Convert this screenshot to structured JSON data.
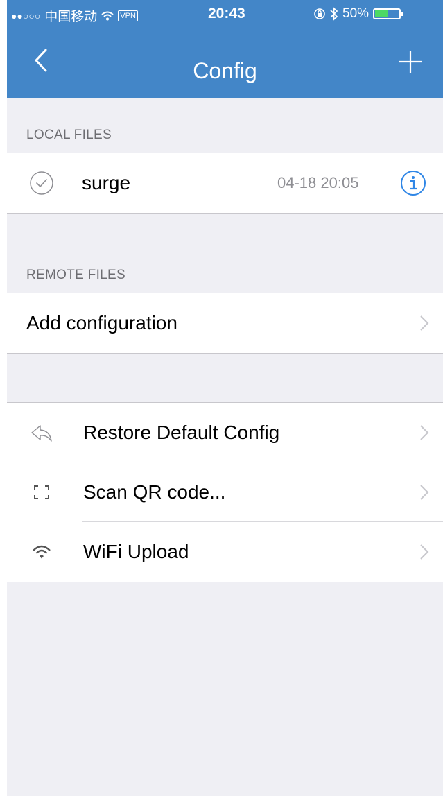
{
  "status_bar": {
    "signal": "●●○○○",
    "carrier": "中国移动",
    "vpn": "VPN",
    "time": "20:43",
    "battery": "50%",
    "battery_level": 0.5
  },
  "nav": {
    "title": "Config",
    "back_icon": "chevron-left-icon",
    "add_icon": "plus-icon"
  },
  "local_files": {
    "header": "LOCAL FILES",
    "items": [
      {
        "name": "surge",
        "date": "04-18 20:05",
        "selected": true
      }
    ]
  },
  "remote_files": {
    "header": "REMOTE FILES",
    "add_label": "Add configuration"
  },
  "actions": [
    {
      "label": "Restore Default Config",
      "icon": "reply-arrow-icon"
    },
    {
      "label": "Scan QR code...",
      "icon": "scan-frame-icon"
    },
    {
      "label": "WiFi Upload",
      "icon": "wifi-icon"
    }
  ],
  "colors": {
    "accent": "#4386c8",
    "background": "#efeff4",
    "info": "#2f86e6"
  }
}
